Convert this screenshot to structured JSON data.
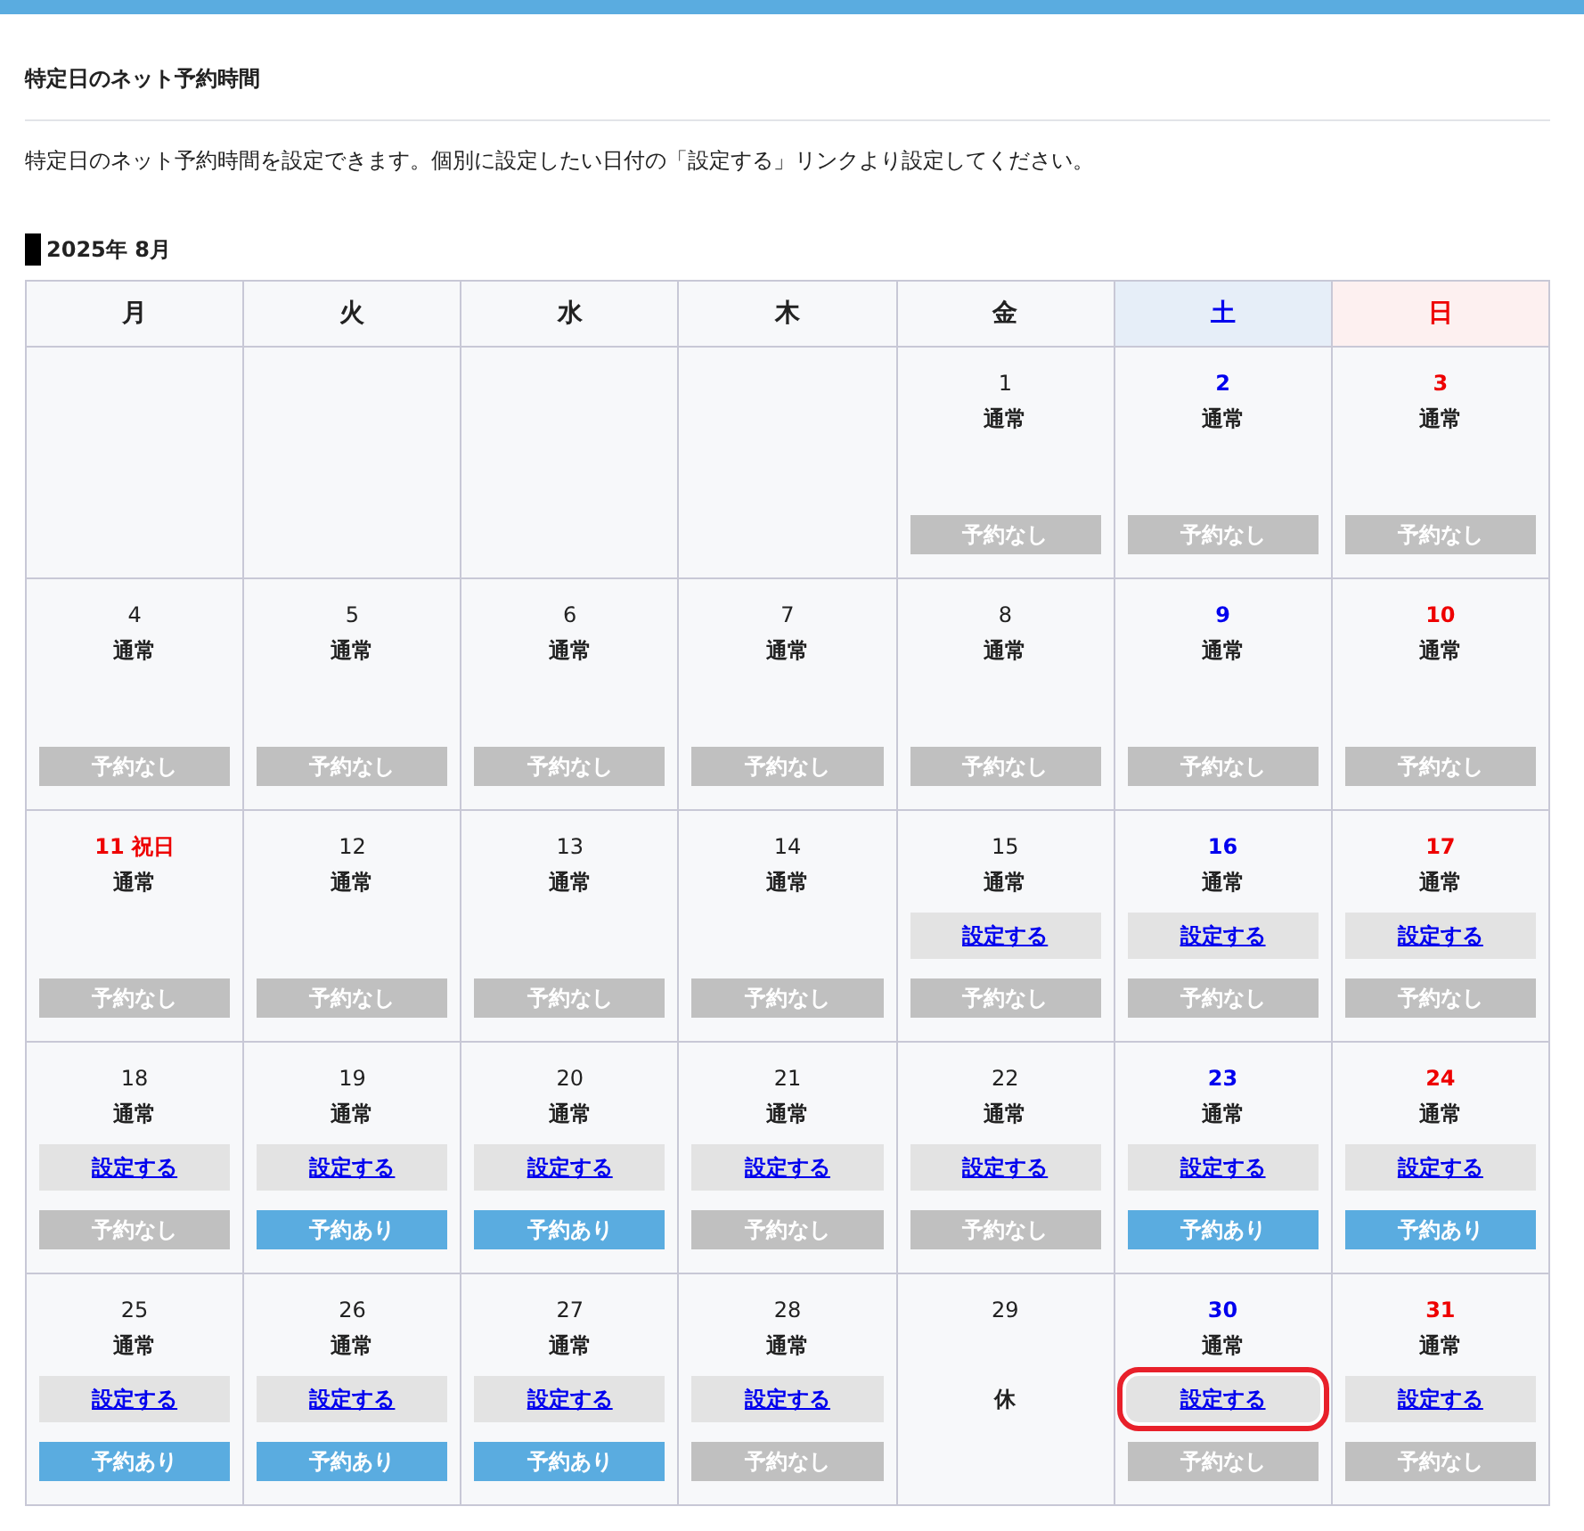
{
  "title": "特定日のネット予約時間",
  "description": "特定日のネット予約時間を設定できます。個別に設定したい日付の「設定する」リンクより設定してください。",
  "month": "2025年 8月",
  "weekdays": [
    {
      "label": "月",
      "kind": "weekday"
    },
    {
      "label": "火",
      "kind": "weekday"
    },
    {
      "label": "水",
      "kind": "weekday"
    },
    {
      "label": "木",
      "kind": "weekday"
    },
    {
      "label": "金",
      "kind": "weekday"
    },
    {
      "label": "土",
      "kind": "saturday"
    },
    {
      "label": "日",
      "kind": "sunday"
    }
  ],
  "days": [
    {
      "kind": "empty"
    },
    {
      "kind": "empty"
    },
    {
      "kind": "empty"
    },
    {
      "kind": "empty"
    },
    {
      "kind": "weekday",
      "day": "1",
      "status": "通常",
      "reservation": {
        "label": "予約なし",
        "reserved": false
      }
    },
    {
      "kind": "saturday",
      "day": "2",
      "status": "通常",
      "reservation": {
        "label": "予約なし",
        "reserved": false
      }
    },
    {
      "kind": "sunday",
      "day": "3",
      "status": "通常",
      "reservation": {
        "label": "予約なし",
        "reserved": false
      }
    },
    {
      "kind": "weekday",
      "day": "4",
      "status": "通常",
      "reservation": {
        "label": "予約なし",
        "reserved": false
      }
    },
    {
      "kind": "weekday",
      "day": "5",
      "status": "通常",
      "reservation": {
        "label": "予約なし",
        "reserved": false
      }
    },
    {
      "kind": "weekday",
      "day": "6",
      "status": "通常",
      "reservation": {
        "label": "予約なし",
        "reserved": false
      }
    },
    {
      "kind": "weekday",
      "day": "7",
      "status": "通常",
      "reservation": {
        "label": "予約なし",
        "reserved": false
      }
    },
    {
      "kind": "weekday",
      "day": "8",
      "status": "通常",
      "reservation": {
        "label": "予約なし",
        "reserved": false
      }
    },
    {
      "kind": "saturday",
      "day": "9",
      "status": "通常",
      "reservation": {
        "label": "予約なし",
        "reserved": false
      }
    },
    {
      "kind": "sunday",
      "day": "10",
      "status": "通常",
      "reservation": {
        "label": "予約なし",
        "reserved": false
      }
    },
    {
      "kind": "holiday",
      "day": "11",
      "holiday": "祝日",
      "status": "通常",
      "reservation": {
        "label": "予約なし",
        "reserved": false
      }
    },
    {
      "kind": "weekday",
      "day": "12",
      "status": "通常",
      "reservation": {
        "label": "予約なし",
        "reserved": false
      }
    },
    {
      "kind": "weekday",
      "day": "13",
      "status": "通常",
      "reservation": {
        "label": "予約なし",
        "reserved": false
      }
    },
    {
      "kind": "weekday",
      "day": "14",
      "status": "通常",
      "reservation": {
        "label": "予約なし",
        "reserved": false
      }
    },
    {
      "kind": "weekday",
      "day": "15",
      "status": "通常",
      "link": {
        "label": "設定する",
        "circled": false
      },
      "reservation": {
        "label": "予約なし",
        "reserved": false
      }
    },
    {
      "kind": "saturday",
      "day": "16",
      "status": "通常",
      "link": {
        "label": "設定する",
        "circled": false
      },
      "reservation": {
        "label": "予約なし",
        "reserved": false
      }
    },
    {
      "kind": "sunday",
      "day": "17",
      "status": "通常",
      "link": {
        "label": "設定する",
        "circled": false
      },
      "reservation": {
        "label": "予約なし",
        "reserved": false
      }
    },
    {
      "kind": "weekday",
      "day": "18",
      "status": "通常",
      "link": {
        "label": "設定する",
        "circled": false
      },
      "reservation": {
        "label": "予約なし",
        "reserved": false
      }
    },
    {
      "kind": "weekday",
      "day": "19",
      "status": "通常",
      "link": {
        "label": "設定する",
        "circled": false
      },
      "reservation": {
        "label": "予約あり",
        "reserved": true
      }
    },
    {
      "kind": "weekday",
      "day": "20",
      "status": "通常",
      "link": {
        "label": "設定する",
        "circled": false
      },
      "reservation": {
        "label": "予約あり",
        "reserved": true
      }
    },
    {
      "kind": "weekday",
      "day": "21",
      "status": "通常",
      "link": {
        "label": "設定する",
        "circled": false
      },
      "reservation": {
        "label": "予約なし",
        "reserved": false
      }
    },
    {
      "kind": "weekday",
      "day": "22",
      "status": "通常",
      "link": {
        "label": "設定する",
        "circled": false
      },
      "reservation": {
        "label": "予約なし",
        "reserved": false
      }
    },
    {
      "kind": "saturday",
      "day": "23",
      "status": "通常",
      "link": {
        "label": "設定する",
        "circled": false
      },
      "reservation": {
        "label": "予約あり",
        "reserved": true
      }
    },
    {
      "kind": "sunday",
      "day": "24",
      "status": "通常",
      "link": {
        "label": "設定する",
        "circled": false
      },
      "reservation": {
        "label": "予約あり",
        "reserved": true
      }
    },
    {
      "kind": "weekday",
      "day": "25",
      "status": "通常",
      "link": {
        "label": "設定する",
        "circled": false
      },
      "reservation": {
        "label": "予約あり",
        "reserved": true
      }
    },
    {
      "kind": "weekday",
      "day": "26",
      "status": "通常",
      "link": {
        "label": "設定する",
        "circled": false
      },
      "reservation": {
        "label": "予約あり",
        "reserved": true
      }
    },
    {
      "kind": "weekday",
      "day": "27",
      "status": "通常",
      "link": {
        "label": "設定する",
        "circled": false
      },
      "reservation": {
        "label": "予約あり",
        "reserved": true
      }
    },
    {
      "kind": "weekday",
      "day": "28",
      "status": "通常",
      "link": {
        "label": "設定する",
        "circled": false
      },
      "reservation": {
        "label": "予約なし",
        "reserved": false
      }
    },
    {
      "kind": "weekday",
      "day": "29",
      "status": "休"
    },
    {
      "kind": "saturday",
      "day": "30",
      "status": "通常",
      "link": {
        "label": "設定する",
        "circled": true
      },
      "reservation": {
        "label": "予約なし",
        "reserved": false
      }
    },
    {
      "kind": "sunday",
      "day": "31",
      "status": "通常",
      "link": {
        "label": "設定する",
        "circled": false
      },
      "reservation": {
        "label": "予約なし",
        "reserved": false
      }
    }
  ]
}
